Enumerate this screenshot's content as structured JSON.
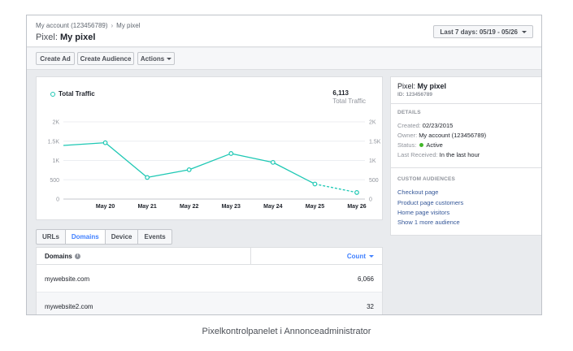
{
  "breadcrumb": {
    "account": "My account (123456789)",
    "current": "My pixel"
  },
  "title": {
    "prefix": "Pixel:",
    "name": "My pixel"
  },
  "date_range": {
    "label": "Last 7 days: 05/19 - 05/26"
  },
  "toolbar": {
    "create_ad": "Create Ad",
    "create_audience": "Create Audience",
    "actions": "Actions"
  },
  "chart_data": {
    "type": "line",
    "legend": "Total Traffic",
    "total_value": "6,113",
    "total_label": "Total Traffic",
    "categories": [
      "May 20",
      "May 21",
      "May 22",
      "May 23",
      "May 24",
      "May 25",
      "May 26"
    ],
    "y_ticks": [
      "0",
      "500",
      "1K",
      "1.5K",
      "2K"
    ],
    "ylim": [
      0,
      2000
    ],
    "series": [
      {
        "name": "Total Traffic",
        "x": [
          "",
          "May 20",
          "May 21",
          "May 22",
          "May 23",
          "May 24",
          "May 25",
          "May 26"
        ],
        "values": [
          1390,
          1460,
          560,
          760,
          1180,
          950,
          390,
          170
        ],
        "dashed_from_index": 6
      }
    ],
    "color": "#1ec8b4"
  },
  "tabs": [
    "URLs",
    "Domains",
    "Device",
    "Events"
  ],
  "active_tab": "Domains",
  "table": {
    "col_domains": "Domains",
    "col_count": "Count",
    "rows": [
      {
        "domain": "mywebsite.com",
        "count": "6,066"
      },
      {
        "domain": "mywebsite2.com",
        "count": "32"
      }
    ]
  },
  "side": {
    "title_prefix": "Pixel:",
    "title_name": "My pixel",
    "id": "ID: 123456789",
    "details_head": "DETAILS",
    "created_label": "Created:",
    "created_value": "02/23/2015",
    "owner_label": "Owner:",
    "owner_value": "My account (123456789)",
    "status_label": "Status:",
    "status_value": "Active",
    "received_label": "Last Received:",
    "received_value": "In the last hour",
    "audiences_head": "CUSTOM AUDIENCES",
    "audiences": [
      "Checkout page",
      "Product page customers",
      "Home page visitors",
      "Show 1 more audience"
    ]
  },
  "caption": "Pixelkontrolpanelet i Annonceadministrator"
}
